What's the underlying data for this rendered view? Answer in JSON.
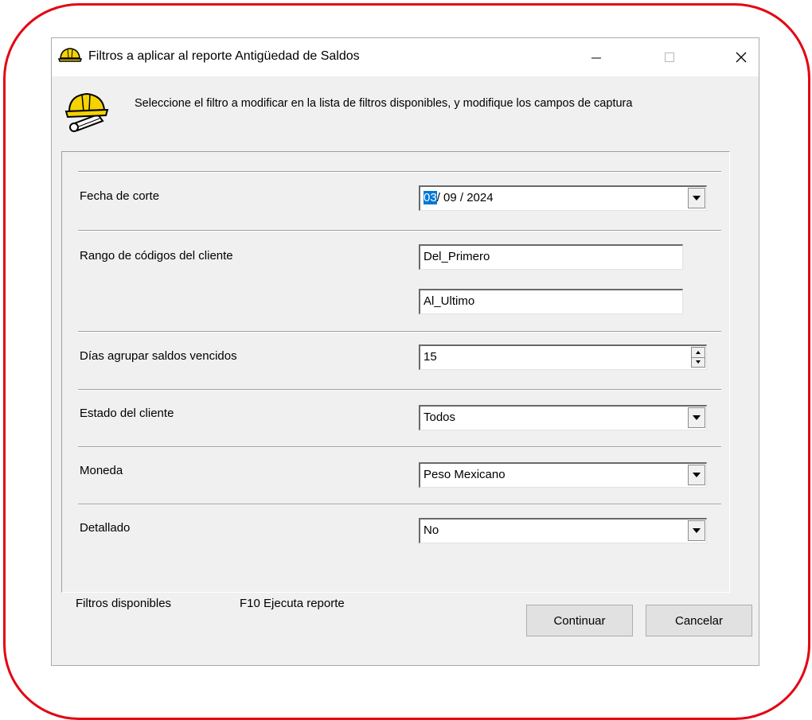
{
  "window": {
    "title": "Filtros a aplicar al reporte Antigüedad de Saldos",
    "icon": "hardhat-icon"
  },
  "instructions": "Seleccione el filtro a modificar  en la lista de filtros disponibles, y modifique los campos de  captura",
  "filters": {
    "fecha": {
      "label": "Fecha de corte",
      "day": "03",
      "rest": "/ 09 / 2024"
    },
    "rango": {
      "label": "Rango de códigos del cliente",
      "from": "Del_Primero",
      "to": "Al_Ultimo"
    },
    "dias": {
      "label": "Días agrupar saldos vencidos",
      "value": "15"
    },
    "estado": {
      "label": "Estado del cliente",
      "value": "Todos"
    },
    "moneda": {
      "label": "Moneda",
      "value": "Peso Mexicano"
    },
    "detallado": {
      "label": "Detallado",
      "value": "No"
    }
  },
  "footer": {
    "filtros_disponibles": "Filtros disponibles",
    "f10": "F10 Ejecuta reporte",
    "continuar": "Continuar",
    "cancelar": "Cancelar"
  },
  "colors": {
    "annotation": "#e30613",
    "selection": "#0078d7",
    "window_bg": "#f0f0f0"
  }
}
